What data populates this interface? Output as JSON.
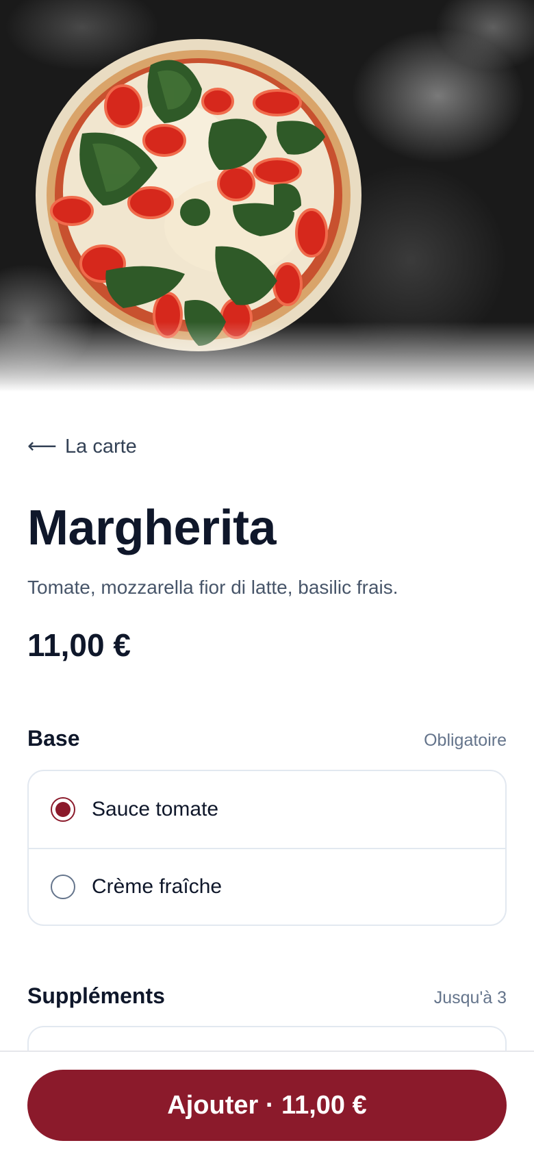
{
  "hero": {
    "image": "pizza-margherita-photo"
  },
  "nav": {
    "back_label": "La carte",
    "back_icon": "arrow-left-icon"
  },
  "product": {
    "name": "Margherita",
    "description": "Tomate, mozzarella fior di latte, basilic frais.",
    "price": "11,00 €"
  },
  "base": {
    "title": "Base",
    "hint": "Obligatoire",
    "options": [
      {
        "label": "Sauce tomate",
        "selected": true
      },
      {
        "label": "Crème fraîche",
        "selected": false
      }
    ]
  },
  "supplements": {
    "title": "Suppléments",
    "hint": "Jusqu'à 3"
  },
  "cta": {
    "label": "Ajouter · 11,00 €"
  },
  "colors": {
    "accent": "#8b1a2b",
    "text": "#0f172a",
    "muted": "#64748b",
    "border": "#e2e8f0"
  }
}
